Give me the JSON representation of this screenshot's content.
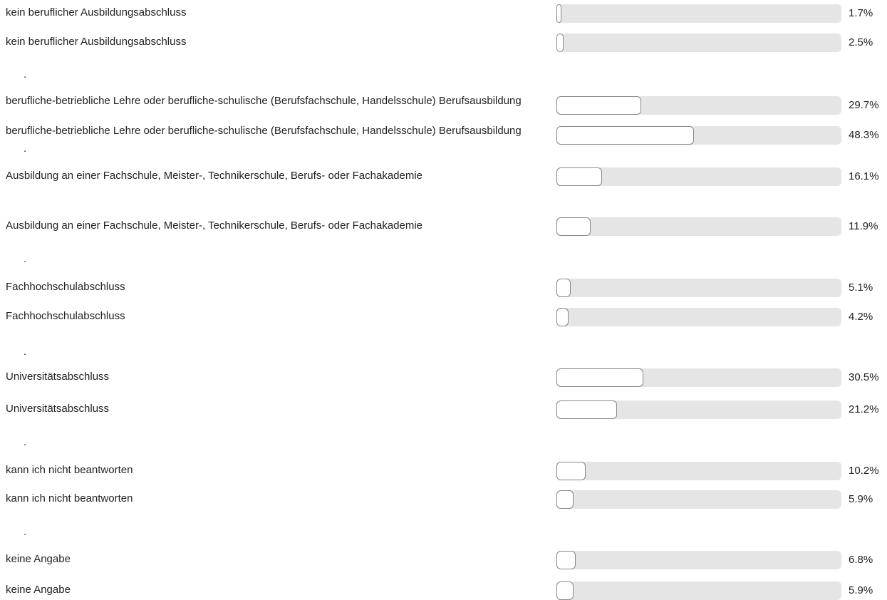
{
  "chart_data": {
    "type": "bar",
    "orientation": "horizontal",
    "xlim": [
      0,
      100
    ],
    "rows": [
      {
        "label": "kein beruflicher Ausbildungsabschluss",
        "value": 1.7,
        "text": "1.7%"
      },
      {
        "label": "kein beruflicher Ausbildungsabschluss",
        "value": 2.5,
        "text": "2.5%"
      },
      {
        "label": "berufliche-betriebliche Lehre oder berufliche-schulische (Berufsfachschule, Handelsschule) Berufsausbildung",
        "value": 29.7,
        "text": "29.7%"
      },
      {
        "label": "berufliche-betriebliche Lehre oder berufliche-schulische (Berufsfachschule, Handelsschule) Berufsausbildung",
        "value": 48.3,
        "text": "48.3%"
      },
      {
        "label": "Ausbildung an einer Fachschule, Meister-, Technikerschule, Berufs- oder Fachakademie",
        "value": 16.1,
        "text": "16.1%"
      },
      {
        "label": "Ausbildung an einer Fachschule, Meister-, Technikerschule, Berufs- oder Fachakademie",
        "value": 11.9,
        "text": "11.9%"
      },
      {
        "label": "Fachhochschulabschluss",
        "value": 5.1,
        "text": "5.1%"
      },
      {
        "label": "Fachhochschulabschluss",
        "value": 4.2,
        "text": "4.2%"
      },
      {
        "label": "Universitätsabschluss",
        "value": 30.5,
        "text": "30.5%"
      },
      {
        "label": "Universitätsabschluss",
        "value": 21.2,
        "text": "21.2%"
      },
      {
        "label": "kann ich nicht beantworten",
        "value": 10.2,
        "text": "10.2%"
      },
      {
        "label": "kann ich nicht beantworten",
        "value": 5.9,
        "text": "5.9%"
      },
      {
        "label": "keine Angabe",
        "value": 6.8,
        "text": "6.8%"
      },
      {
        "label": "keine Angabe",
        "value": 5.9,
        "text": "5.9%"
      }
    ],
    "separator": "."
  },
  "colors": {
    "track": "#e5e5e5",
    "fill": "#ffffff",
    "fill_border": "#888888",
    "text": "#222222"
  }
}
